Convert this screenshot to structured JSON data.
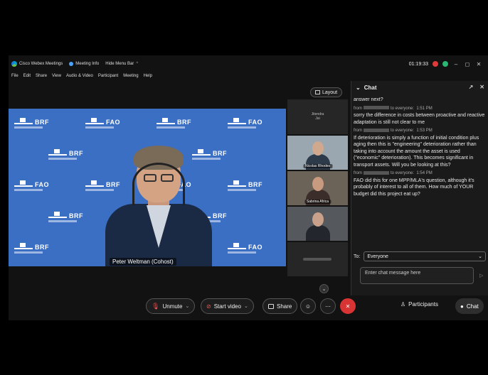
{
  "titlebar": {
    "app_name": "Cisco Webex Meetings",
    "meeting_info": "Meeting Info",
    "hide_menu": "Hide Menu Bar",
    "hide_menu_chevron": "^",
    "time": "01:19:33",
    "win_minimize": "–",
    "win_maximize": "◻",
    "win_close": "✕"
  },
  "menubar": [
    "File",
    "Edit",
    "Share",
    "View",
    "Audio & Video",
    "Participant",
    "Meeting",
    "Help"
  ],
  "backdrop": {
    "logo_a": "BRF",
    "logo_b": "FAO"
  },
  "main_video": {
    "speaker_name": "Peter Weltman (Cohost)"
  },
  "layout_button": {
    "label": "Layout"
  },
  "thumbnails": [
    {
      "top_label": "Jitendra\nJai"
    },
    {
      "label": "Nicolas Rhodes"
    },
    {
      "label": "Sabrina Africa"
    },
    {
      "label": ""
    },
    {
      "label": ""
    }
  ],
  "scroll_down": "⌄",
  "chat": {
    "title": "Chat",
    "collapse_icon": "⌄",
    "popout_icon": "↗",
    "close_icon": "✕",
    "partial_line": "answer next?",
    "messages": [
      {
        "from": "from",
        "to": "to everyone:",
        "time": "1:51 PM",
        "text": "sorry the difference in costs between proactive and reactive adaptation is still not clear to me"
      },
      {
        "from": "from",
        "to": "to everyone:",
        "time": "1:53 PM",
        "text": "If deterioration is simply a function of initial condition plus aging then this is \"engineering\" deterioration rather than taking into account the amount the asset is used (\"economic\" deterioration). This becomes significant in transport assets. Will you be looking at this?"
      },
      {
        "from": "from",
        "to": "to everyone:",
        "time": "1:54 PM",
        "text": "FAO did this for one MPP/MLA's question, although it's probably of interest to all of them. How much of YOUR budget did this project eat up?"
      }
    ],
    "to_label": "To:",
    "recipient": "Everyone",
    "recipient_chevron": "⌄",
    "input_placeholder": "Enter chat message here",
    "send_icon": "▷"
  },
  "toolbar": {
    "unmute": "Unmute",
    "start_video": "Start video",
    "share": "Share",
    "reactions_icon": "☺",
    "more_icon": "⋯",
    "end_icon": "✕",
    "participants": "Participants",
    "chat": "Chat",
    "mic_glyph": "🎙",
    "cam_glyph": "⊘",
    "chevron": "⌄",
    "participants_glyph": "♙",
    "chat_glyph": "●"
  }
}
